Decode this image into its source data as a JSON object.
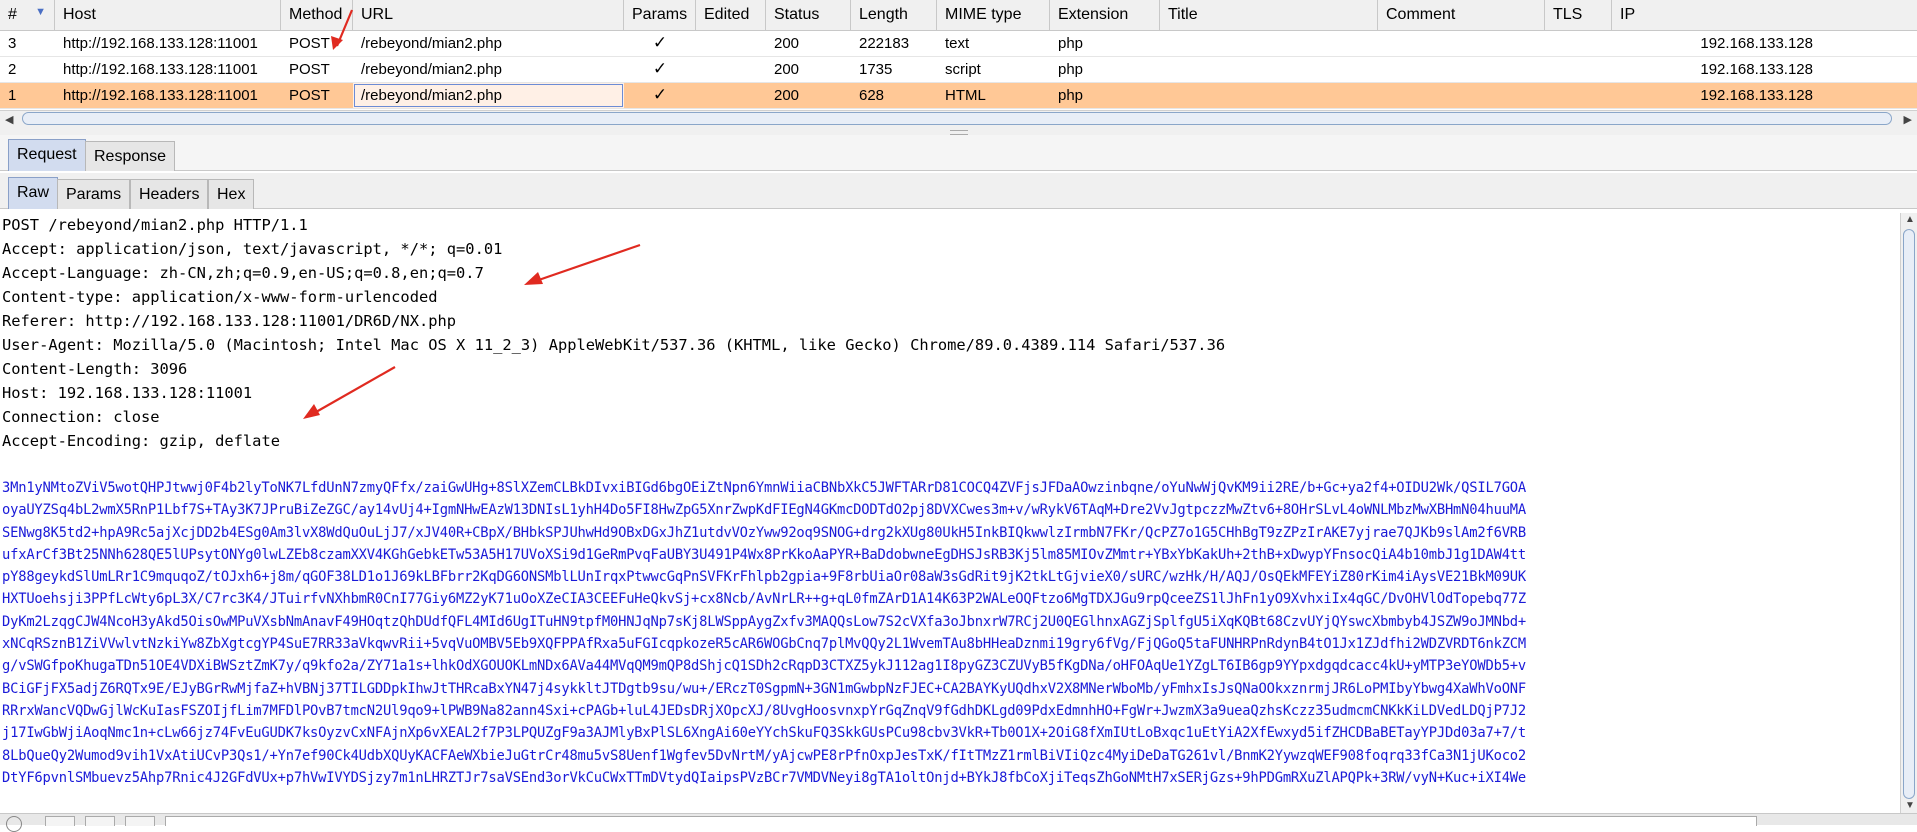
{
  "columns": [
    "#",
    "Host",
    "Method",
    "URL",
    "Params",
    "Edited",
    "Status",
    "Length",
    "MIME type",
    "Extension",
    "Title",
    "Comment",
    "TLS",
    "IP"
  ],
  "rows": [
    {
      "num": "3",
      "host": "http://192.168.133.128:11001",
      "method": "POST",
      "url": "/rebeyond/mian2.php",
      "params": "✓",
      "edited": "",
      "status": "200",
      "length": "222183",
      "mime": "text",
      "ext": "php",
      "title": "",
      "comment": "",
      "tls": "",
      "ip": "192.168.133.128"
    },
    {
      "num": "2",
      "host": "http://192.168.133.128:11001",
      "method": "POST",
      "url": "/rebeyond/mian2.php",
      "params": "✓",
      "edited": "",
      "status": "200",
      "length": "1735",
      "mime": "script",
      "ext": "php",
      "title": "",
      "comment": "",
      "tls": "",
      "ip": "192.168.133.128"
    },
    {
      "num": "1",
      "host": "http://192.168.133.128:11001",
      "method": "POST",
      "url": "/rebeyond/mian2.php",
      "params": "✓",
      "edited": "",
      "status": "200",
      "length": "628",
      "mime": "HTML",
      "ext": "php",
      "title": "",
      "comment": "",
      "tls": "",
      "ip": "192.168.133.128"
    }
  ],
  "outer_tabs": [
    "Request",
    "Response"
  ],
  "inner_tabs": [
    "Raw",
    "Params",
    "Headers",
    "Hex"
  ],
  "request": {
    "headers": [
      "POST /rebeyond/mian2.php HTTP/1.1",
      "Accept: application/json, text/javascript, */*; q=0.01",
      "Accept-Language: zh-CN,zh;q=0.9,en-US;q=0.8,en;q=0.7",
      "Content-type: application/x-www-form-urlencoded",
      "Referer: http://192.168.133.128:11001/DR6D/NX.php",
      "User-Agent: Mozilla/5.0 (Macintosh; Intel Mac OS X 11_2_3) AppleWebKit/537.36 (KHTML, like Gecko) Chrome/89.0.4389.114 Safari/537.36",
      "Content-Length: 3096",
      "Host: 192.168.133.128:11001",
      "Connection: close",
      "Accept-Encoding: gzip, deflate"
    ],
    "body": [
      "3Mn1yNMtoZViV5wotQHPJtwwj0F4b2lyToNK7LfdUnN7zmyQFfx/zaiGwUHg+8SlXZemCLBkDIvxiBIGd6bgOEiZtNpn6YmnWiiaCBNbXkC5JWFTARrD81COCQ4ZVFjsJFDaAOwzinbqne/oYuNwWjQvKM9ii2RE/b+Gc+ya2f4+OIDU2Wk/QSIL7GOA",
      "oyaUYZSq4bL2wmX5RnP1Lbf7S+TAy3K7JPruBiZeZGC/ay14vUj4+IgmNHwEAzW13DNIsL1yhH4Do5FI8HwZpG5XnrZwpKdFIEgN4GKmcDODTdO2pj8DVXCwes3m+v/wRykV6TAqM+Dre2VvJgtpczzMwZtv6+8OHrSLvL4oWNLMbzMwXBHmN04huuMA",
      "SENwg8K5td2+hpA9Rc5ajXcjDD2b4ESg0Am3lvX8WdQuOuLjJ7/xJV40R+CBpX/BHbkSPJUhwHd9OBxDGxJhZ1utdvVOzYww92oq9SNOG+drg2kXUg80UkH5InkBIQkwwlzIrmbN7FKr/QcPZ7o1G5CHhBgT9zZPzIrAKE7yjrae7QJKb9slAm2f6VRB",
      "ufxArCf3Bt25NNh628QE5lUPsytONYg0lwLZEb8czamXXV4KGhGebkETw53A5H17UVoXSi9d1GeRmPvqFaUBY3U491P4Wx8PrKkoAaPYR+BaDdobwneEgDHSJsRB3Kj5lm85MIOvZMmtr+YBxYbKakUh+2thB+xDwypYFnsocQiA4b10mbJ1g1DAW4tt",
      "pY88geykdSlUmLRr1C9mquqoZ/tOJxh6+j8m/qGOF38LD1o1J69kLBFbrr2KqDG6ONSMblLUnIrqxPtwwcGqPnSVFKrFhlpb2gpia+9F8rbUiaOr08aW3sGdRit9jK2tkLtGjvieX0/sURC/wzHk/H/AQJ/OsQEkMFEYiZ80rKim4iAysVE21BkM09UK",
      "HXTUoehsji3PPfLcWty6pL3X/C7rc3K4/JTuirfvNXhbmR0CnI77Giy6MZ2yK71uOoXZeCIA3CEEFuHeQkvSj+cx8Ncb/AvNrLR++g+qL0fmZArD1A14K63P2WALeOQFtzo6MgTDXJGu9rpQceeZS1lJhFn1yO9XvhxiIx4qGC/DvOHVlOdTopebq77Z",
      "DyKm2LzqgCJW4NcoH3yAkd5OisOwMPuVXsbNmAnavF49HOqtzQhDUdfQFL4MId6UgITuHN9tpfM0HNJqNp7sKj8LWSppAygZxfv3MAQQsLow7S2cVXfa3oJbnxrW7RCj2U0QEGlhnxAGZjSplfgU5iXqKQBt68CzvUYjQYswcXbmbyb4JSZW9oJMNbd+",
      "xNCqRSznB1ZiVVwlvtNzkiYw8ZbXgtcgYP4SuE7RR33aVkqwvRii+5vqVuOMBV5Eb9XQFPPAfRxa5uFGIcqpkozeR5cAR6WOGbCnq7plMvQQy2L1WvemTAu8bHHeaDznmi19gry6fVg/FjQGoQ5taFUNHRPnRdynB4tO1Jx1ZJdfhi2WDZVRDT6nkZCM",
      "g/vSWGfpoKhugaTDn51OE4VDXiBWSztZmK7y/q9kfo2a/ZY71a1s+lhkOdXGOUOKLmNDx6AVa44MVqQM9mQP8dShjcQ1SDh2cRqpD3CTXZ5ykJ112ag1I8pyGZ3CZUVyB5fKgDNa/oHFOAqUe1YZgLT6IB6gp9YYpxdgqdcacc4kU+yMTP3eYOWDb5+v",
      "BCiGFjFX5adjZ6RQTx9E/EJyBGrRwMjfaZ+hVBNj37TILGDDpkIhwJtTHRcaBxYN47j4sykkltJTDgtb9su/wu+/ERczT0SgpmN+3GN1mGwbpNzFJEC+CA2BAYKyUQdhxV2X8MNerWboMb/yFmhxIsJsQNaOOkxznrmjJR6LoPMIbyYbwg4XaWhVoONF",
      "RRrxWancVQDwGjlWcKuIasFSZOIjfLim7MFDlPOvB7tmcN2Ul9qo9+lPWB9Na82ann4Sxi+cPAGb+luL4JEDsDRjXOpcXJ/8UvgHoosvnxpYrGqZnqV9fGdhDKLgd09PdxEdmnhHO+FgWr+JwzmX3a9ueaQzhsKczz35udmcmCNKkKiLDVedLDQjP7J2",
      "j17IwGbWjiAoqNmc1n+cLw66jz74FvEuGUDK7ksOyzvCxNFAjnXp6vXEAL2f7P3LPQUZgF9a3AJMlyBxPlSL6XngAi60eYYchSkuFQ3SkkGUsPCu98cbv3VkR+Tb0O1X+2OiG8fXmIUtLoBxqc1uEtYiA2XfEwxyd5ifZHCDBaBETayYPJDd03a7+7/t",
      "8LbQueQy2Wumod9vih1VxAtiUCvP3Qs1/+Yn7ef90Ck4UdbXQUyKACFAeWXbieJuGtrCr48mu5vS8Uenf1Wgfev5DvNrtM/yAjcwPE8rPfnOxpJesTxK/fItTMzZ1rmlBiVIiQzc4MyiDeDaTG261vl/BnmK2YywzqWEF908foqrq33fCa3N1jUKoco2",
      "DtYF6pvnlSMbuevz5Ahp7Rnic4J2GFdVUx+p7hVwIVYDSjzy7m1nLHRZTJr7saVSEnd3orVkCuCWxTTmDVtydQIaipsPVzBCr7VMDVNeyi8gTA1oltOnjd+BYkJ8fbCoXjiTeqsZhGoNMtH7xSERjGzs+9hPDGmRXuZlAPQPk+3RW/vyN+Kuc+iXI4We"
    ]
  },
  "colors": {
    "selected_row": "#ffc896",
    "body_text": "#1a1ad8",
    "arrow": "#e02a20",
    "active_tab": "#d2dcef"
  }
}
